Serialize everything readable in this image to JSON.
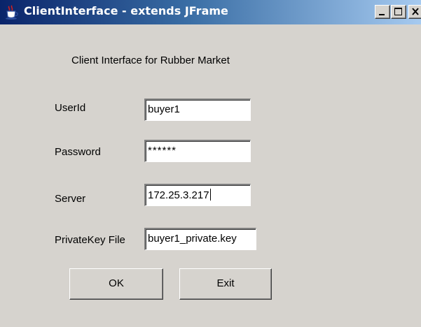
{
  "window": {
    "title": "ClientInterface - extends JFrame",
    "controls": {
      "minimize_icon": "minimize-icon",
      "maximize_icon": "maximize-icon",
      "close_icon": "close-icon"
    }
  },
  "form": {
    "heading": "Client Interface for Rubber Market",
    "fields": {
      "userid": {
        "label": "UserId",
        "value": "buyer1"
      },
      "password": {
        "label": "Password",
        "value": "******"
      },
      "server": {
        "label": "Server",
        "value": "172.25.3.217"
      },
      "private_key": {
        "label": "PrivateKey File",
        "value": "buyer1_private.key"
      }
    },
    "buttons": {
      "ok": "OK",
      "exit": "Exit"
    }
  },
  "colors": {
    "window_background": "#d6d3ce",
    "titlebar_start": "#0a246a",
    "titlebar_end": "#a6caf0",
    "field_background": "#ffffff"
  }
}
